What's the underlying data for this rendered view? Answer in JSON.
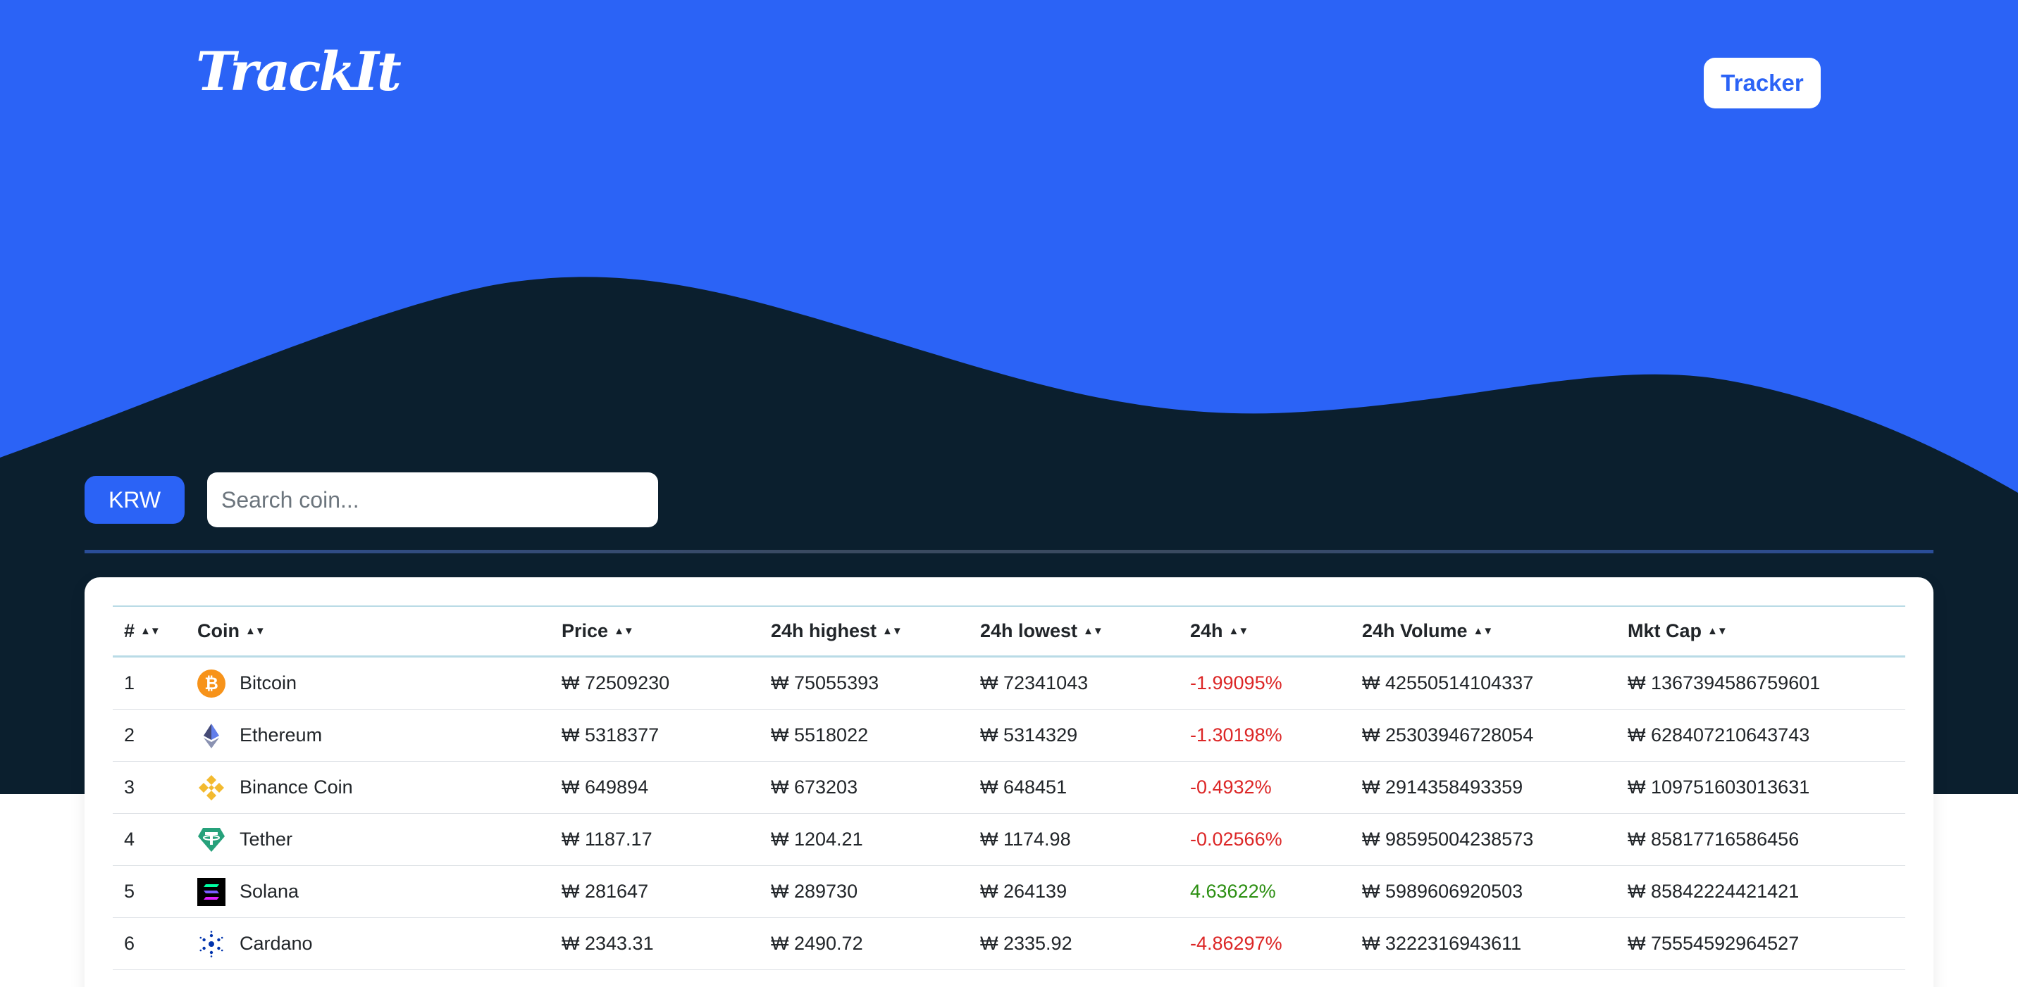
{
  "header": {
    "logo": "TrackIt",
    "nav_button": "Tracker"
  },
  "controls": {
    "currency": "KRW",
    "search_placeholder": "Search coin...",
    "search_value": ""
  },
  "table": {
    "columns": [
      "#",
      "Coin",
      "Price",
      "24h highest",
      "24h lowest",
      "24h",
      "24h Volume",
      "Mkt Cap"
    ],
    "sort_indicator": "▲▼",
    "rows": [
      {
        "rank": "1",
        "coin": "Bitcoin",
        "icon": "bitcoin-icon",
        "price": "₩ 72509230",
        "high": "₩ 75055393",
        "low": "₩ 72341043",
        "change": "-1.99095%",
        "trend": "down",
        "volume": "₩ 42550514104337",
        "mktcap": "₩ 1367394586759601"
      },
      {
        "rank": "2",
        "coin": "Ethereum",
        "icon": "ethereum-icon",
        "price": "₩ 5318377",
        "high": "₩ 5518022",
        "low": "₩ 5314329",
        "change": "-1.30198%",
        "trend": "down",
        "volume": "₩ 25303946728054",
        "mktcap": "₩ 628407210643743"
      },
      {
        "rank": "3",
        "coin": "Binance Coin",
        "icon": "binance-coin-icon",
        "price": "₩ 649894",
        "high": "₩ 673203",
        "low": "₩ 648451",
        "change": "-0.4932%",
        "trend": "down",
        "volume": "₩ 2914358493359",
        "mktcap": "₩ 109751603013631"
      },
      {
        "rank": "4",
        "coin": "Tether",
        "icon": "tether-icon",
        "price": "₩ 1187.17",
        "high": "₩ 1204.21",
        "low": "₩ 1174.98",
        "change": "-0.02566%",
        "trend": "down",
        "volume": "₩ 98595004238573",
        "mktcap": "₩ 85817716586456"
      },
      {
        "rank": "5",
        "coin": "Solana",
        "icon": "solana-icon",
        "price": "₩ 281647",
        "high": "₩ 289730",
        "low": "₩ 264139",
        "change": "4.63622%",
        "trend": "up",
        "volume": "₩ 5989606920503",
        "mktcap": "₩ 85842224421421"
      },
      {
        "rank": "6",
        "coin": "Cardano",
        "icon": "cardano-icon",
        "price": "₩ 2343.31",
        "high": "₩ 2490.72",
        "low": "₩ 2335.92",
        "change": "-4.86297%",
        "trend": "down",
        "volume": "₩ 3222316943611",
        "mktcap": "₩ 75554592964527"
      }
    ]
  },
  "colors": {
    "brand_blue": "#2b63f6",
    "dark_navy": "#0b1f2e",
    "negative": "#dc2626",
    "positive": "#2c8f12"
  }
}
